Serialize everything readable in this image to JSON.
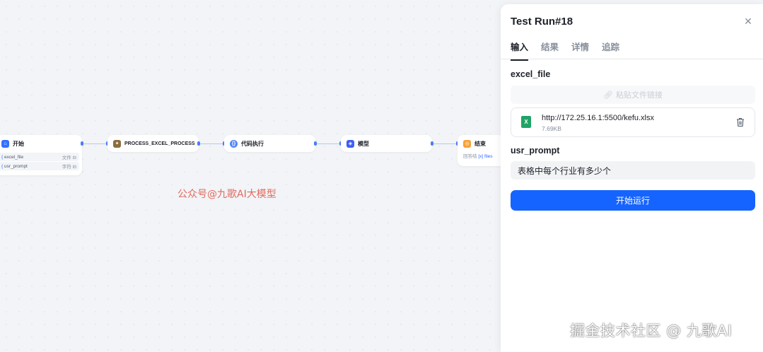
{
  "workflow": {
    "nodes": [
      {
        "id": "start",
        "title": "开始",
        "variables": [
          {
            "name": "excel_file",
            "type": "文件 ⊟"
          },
          {
            "name": "usr_prompt",
            "type": "字符 ⊟"
          }
        ]
      },
      {
        "id": "process",
        "title": "PROCESS_EXCEL_PROCESS"
      },
      {
        "id": "code",
        "title": "代码执行"
      },
      {
        "id": "model",
        "title": "模型"
      },
      {
        "id": "end",
        "title": "结束",
        "output": {
          "label": "回答结",
          "link": "[x] files"
        }
      }
    ],
    "colors": {
      "start": "#3370ff",
      "process": "#ffffff",
      "code": "#4e86f7",
      "model": "#3d5ff5",
      "end": "#f7a035",
      "edge": "#b9c6e6"
    }
  },
  "watermark": {
    "center": "公众号@九歌AI大模型",
    "corner": "掘金技术社区 @ 九歌AI"
  },
  "panel": {
    "title": "Test Run#18",
    "close_icon": "close-icon",
    "tabs": [
      {
        "label": "输入",
        "active": true
      },
      {
        "label": "结果",
        "active": false
      },
      {
        "label": "详情",
        "active": false
      },
      {
        "label": "追踪",
        "active": false
      }
    ],
    "excel_field": {
      "label": "excel_file",
      "paste_placeholder": "粘贴文件链接",
      "file": {
        "url": "http://172.25.16.1:5500/kefu.xlsx",
        "size": "7.69KB",
        "icon": "excel-icon"
      }
    },
    "prompt_field": {
      "label": "usr_prompt",
      "value": "表格中每个行业有多少个"
    },
    "run_button": "开始运行",
    "accent_color": "#1664ff"
  }
}
